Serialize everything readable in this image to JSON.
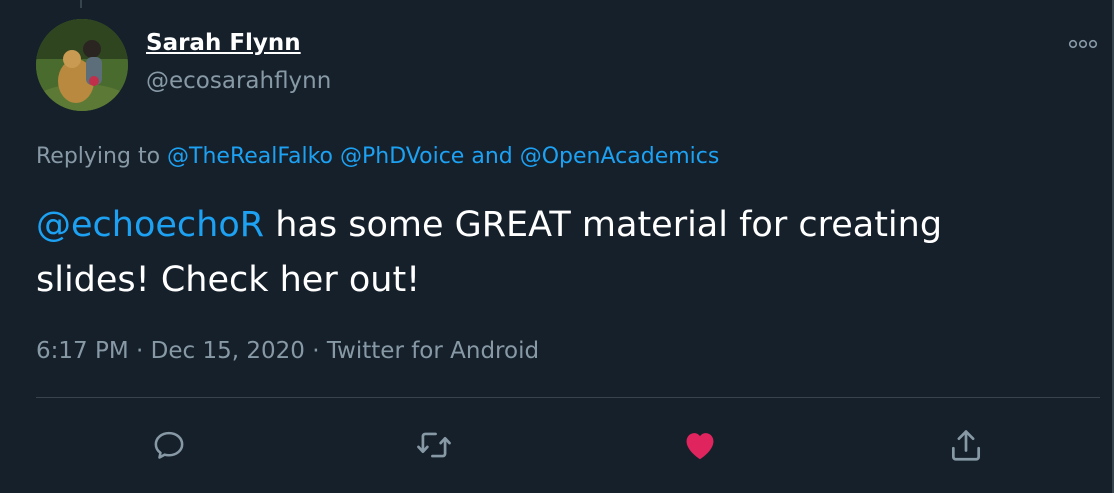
{
  "tweet": {
    "author_name": "Sarah Flynn",
    "author_handle": "@ecosarahflynn",
    "replying_prefix": "Replying to",
    "reply_to": [
      "@TheRealFalko",
      "@PhDVoice"
    ],
    "reply_joiner": "and",
    "reply_last": "@OpenAcademics",
    "mention": "@echoechoR",
    "text_rest": "has some GREAT material for creating slides! Check her out!",
    "time": "6:17 PM",
    "separator": "·",
    "date": "Dec 15, 2020",
    "source": "Twitter for Android"
  },
  "actions": {
    "reply_icon": "reply-icon",
    "retweet_icon": "retweet-icon",
    "like_icon": "heart-icon",
    "share_icon": "share-icon",
    "liked": true
  },
  "colors": {
    "background": "#15202b",
    "link": "#1da1f2",
    "muted": "#8899a6",
    "like": "#e0245e"
  }
}
